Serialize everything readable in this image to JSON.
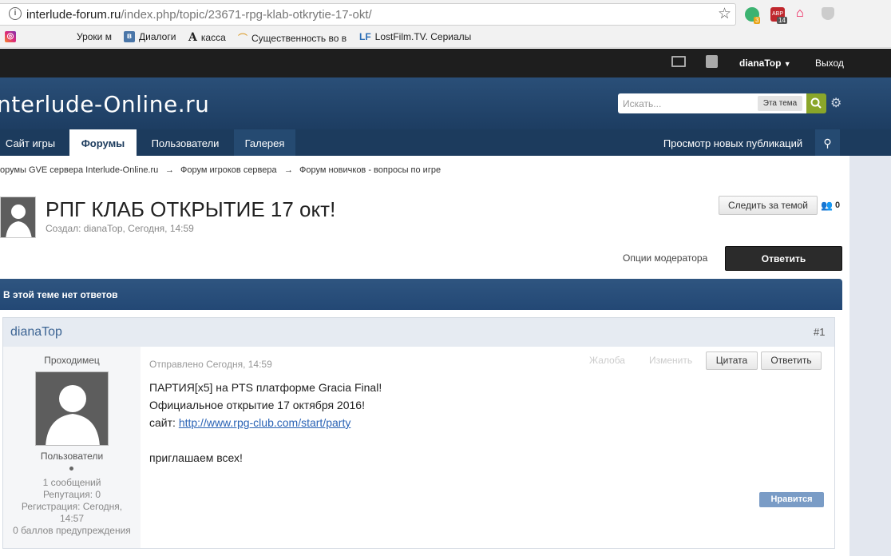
{
  "browser": {
    "url_domain": "interlude-forum.ru",
    "url_path": "/index.php/topic/23671-rpg-klab-otkrytie-17-okt/",
    "ext_badge_1": "3",
    "ext_badge_2": "14",
    "ext_abp_label": "ABP"
  },
  "bookmarks": [
    {
      "label": "Уроки м",
      "icon": "instagram-icon"
    },
    {
      "label": "Диалоги",
      "icon": "vk-icon"
    },
    {
      "label": "касса",
      "icon": "letter-a-icon"
    },
    {
      "label": "Существенность во в",
      "icon": "rainbow-icon"
    },
    {
      "label": "LostFilm.TV. Сериалы",
      "icon": "lf-icon"
    }
  ],
  "userbar": {
    "username": "dianaTop",
    "logout": "Выход"
  },
  "header": {
    "logo": "nterlude-Online.ru",
    "search_placeholder": "Искать...",
    "search_scope": "Эта тема"
  },
  "nav": {
    "tabs": [
      "Сайт игры",
      "Форумы",
      "Пользователи",
      "Галерея"
    ],
    "new_posts": "Просмотр новых публикаций"
  },
  "breadcrumb": [
    "орумы GVE сервера Interlude-Online.ru",
    "→",
    "Форум игроков сервера",
    "→",
    "Форум новичков - вопросы по игре"
  ],
  "topic": {
    "title": "РПГ КЛАБ ОТКРЫТИЕ 17 окт!",
    "meta": "Создал: dianaTop, Сегодня, 14:59",
    "follow_label": "Следить за темой",
    "follow_count": "0",
    "mod_options": "Опции модератора",
    "reply_label": "Ответить",
    "no_replies": "В этой теме нет ответов"
  },
  "post": {
    "author": "dianaTop",
    "number": "#1",
    "rank": "Проходимец",
    "group": "Пользователи",
    "stats": [
      "1 сообщений",
      "Репутация: 0",
      "Регистрация: Сегодня,",
      "14:57",
      "0 баллов предупреждения"
    ],
    "posted": "Отправлено Сегодня, 14:59",
    "report": "Жалоба",
    "edit": "Изменить",
    "quote": "Цитата",
    "reply": "Ответить",
    "lines": [
      "ПАРТИЯ[x5] на PTS платформе Gracia Final!",
      "Официальное открытие 17 октября 2016!",
      "сайт: "
    ],
    "link": "http://www.rpg-club.com/start/party",
    "closing": "приглашаем всех!",
    "like": "Нравится"
  },
  "colors": {
    "header_blue": "#234875",
    "nav_dark": "#1c3b5d",
    "search_green": "#8aa62a",
    "link_blue": "#2a63b5"
  }
}
